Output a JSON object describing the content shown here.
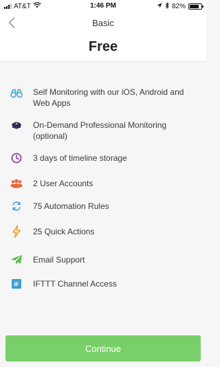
{
  "status_bar": {
    "carrier": "AT&T",
    "time": "1:46 PM",
    "battery": "82%",
    "battery_level": 0.82,
    "icons": [
      "signal-icon",
      "wifi-icon",
      "location-icon",
      "bluetooth-icon",
      "battery-icon"
    ]
  },
  "header": {
    "title": "Basic",
    "plan_name": "Free",
    "back_icon": "chevron-left-icon"
  },
  "features": [
    {
      "label": "Self Monitoring with our iOS, Android and Web Apps",
      "icon": "binoculars-icon",
      "color": "#4aa6d8"
    },
    {
      "label": "On-Demand Professional Monitoring (optional)",
      "icon": "police-cap-icon",
      "color": "#2d2f5e"
    },
    {
      "label": "3 days of timeline storage",
      "icon": "clock-icon",
      "color": "#8e44ad"
    },
    {
      "label": "2 User Accounts",
      "icon": "users-icon",
      "color": "#e8663d"
    },
    {
      "label": "75 Automation Rules",
      "icon": "sync-icon",
      "color": "#3aa0d8"
    },
    {
      "label": "25 Quick Actions",
      "icon": "lightning-icon",
      "color": "#f0a030"
    },
    {
      "label": "Email Support",
      "icon": "paper-plane-icon",
      "color": "#5cbf4c"
    },
    {
      "label": "IFTTT Channel Access",
      "icon": "ifttt-icon",
      "color": "#3aa0d8"
    }
  ],
  "continue_button": {
    "label": "Continue",
    "color": "#79cf6a"
  }
}
